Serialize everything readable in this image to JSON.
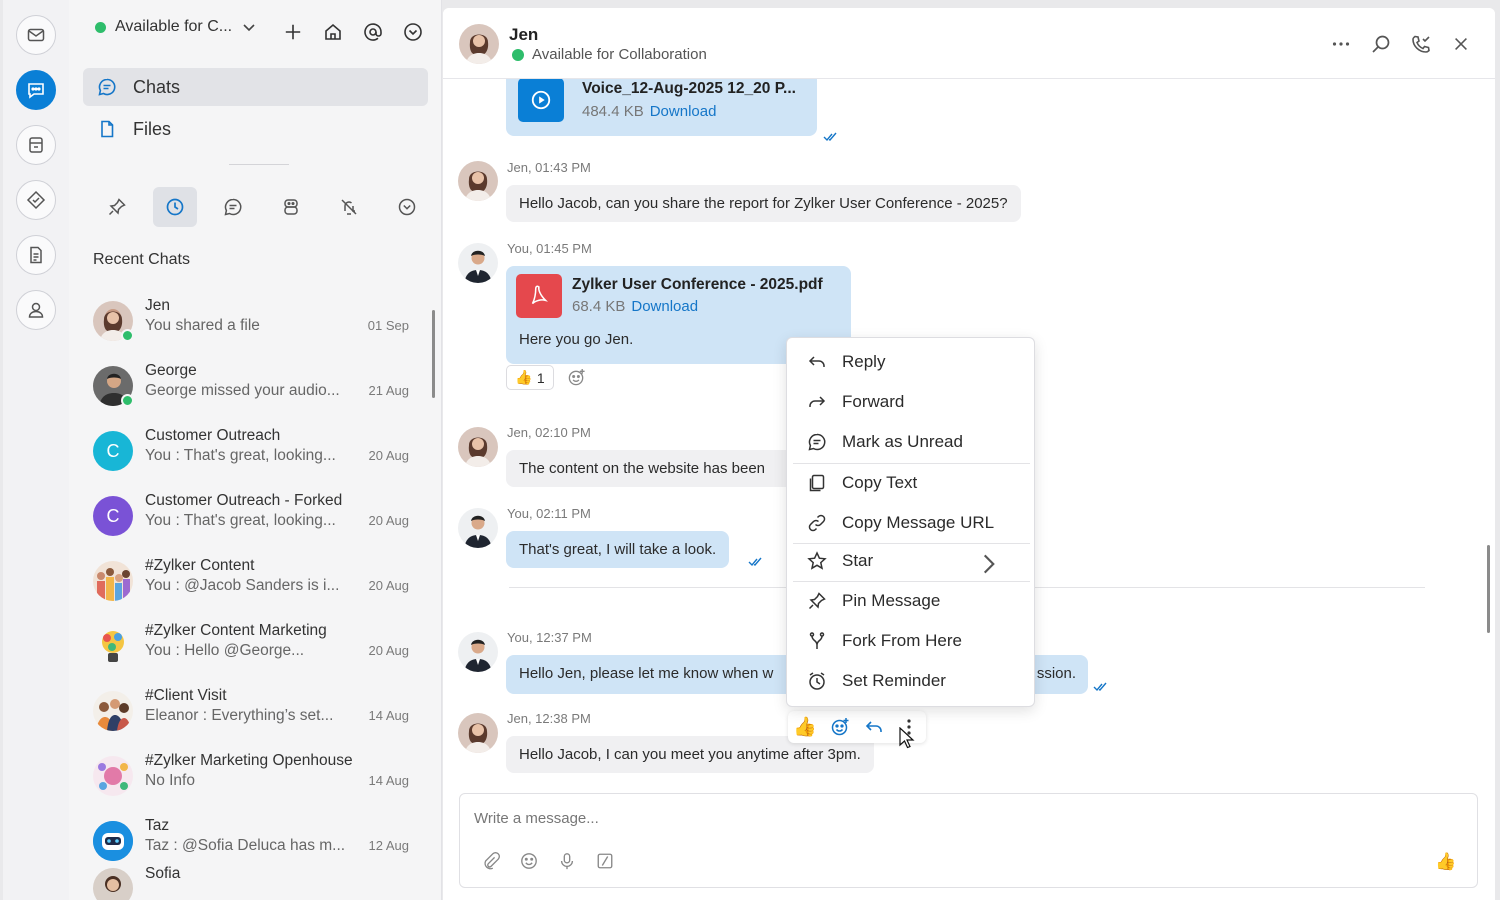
{
  "colors": {
    "accent": "#0a7fd6",
    "online": "#2ebd6b",
    "my_bubble": "#cfe4f6",
    "their_bubble": "#f0f0f2",
    "link": "#1576c8"
  },
  "rail": {
    "items": [
      "mail-icon",
      "chat-icon",
      "cart-icon",
      "verified-badge-icon",
      "notes-icon",
      "contacts-icon"
    ],
    "active": "chat-icon"
  },
  "sidebar": {
    "status_label": "Available for C...",
    "nav": [
      {
        "label": "Chats",
        "icon": "chat-bubble-icon",
        "active": true
      },
      {
        "label": "Files",
        "icon": "file-icon",
        "active": false
      }
    ],
    "filters": [
      "pin-icon",
      "clock-icon",
      "chat-bubble-icon",
      "bot-icon",
      "mute-icon",
      "chevron-circle-icon"
    ],
    "recent_title": "Recent Chats",
    "chats": [
      {
        "name": "Jen",
        "preview": "You shared a file",
        "date": "01 Sep",
        "online": true
      },
      {
        "name": "George",
        "preview": "George missed your audio...",
        "date": "21 Aug",
        "online": true
      },
      {
        "name": "Customer Outreach",
        "preview": "You : That's great, looking...",
        "date": "20 Aug",
        "initial": "C",
        "color": "#18b6d6"
      },
      {
        "name": "Customer Outreach - Forked",
        "preview": "You : That's great, looking...",
        "date": "20 Aug",
        "initial": "C",
        "color": "#7a52d6"
      },
      {
        "name": "#Zylker Content",
        "preview": "You : @Jacob Sanders is i...",
        "date": "20 Aug"
      },
      {
        "name": "#Zylker Content Marketing",
        "preview": "You : Hello @George...",
        "date": "20 Aug"
      },
      {
        "name": "#Client Visit",
        "preview": "Eleanor : Everything’s set...",
        "date": "14 Aug"
      },
      {
        "name": "#Zylker Marketing Openhouse",
        "preview": "No Info",
        "date": "14 Aug"
      },
      {
        "name": "Taz",
        "preview": "Taz : @Sofia Deluca has m...",
        "date": "12 Aug"
      },
      {
        "name": "Sofia",
        "preview": "",
        "date": ""
      }
    ]
  },
  "header": {
    "name": "Jen",
    "status": "Available for Collaboration"
  },
  "messages": {
    "voice": {
      "name": "Voice_12-Aug-2025 12_20 P...",
      "size": "484.4 KB",
      "action": "Download"
    },
    "m1": {
      "meta": "Jen, 01:43 PM",
      "text": "Hello Jacob, can you share the report for Zylker User Conference - 2025?"
    },
    "m2": {
      "meta": "You, 01:45 PM",
      "file": "Zylker User Conference - 2025.pdf",
      "size": "68.4 KB",
      "action": "Download",
      "text": "Here you go Jen.",
      "reaction": "👍",
      "reaction_count": "1"
    },
    "m3": {
      "meta": "Jen, 02:10 PM",
      "text": "The content on the website has been"
    },
    "m4": {
      "meta": "You, 02:11 PM",
      "text": "That's great, I will take a look."
    },
    "m5": {
      "meta": "You, 12:37 PM",
      "text_left": "Hello Jen, please let me know when w",
      "text_right": "ssion."
    },
    "m6": {
      "meta": "Jen, 12:38 PM",
      "text": "Hello Jacob, I can you meet you anytime after 3pm."
    }
  },
  "composer": {
    "placeholder": "Write a message..."
  },
  "context_menu": {
    "items": [
      {
        "label": "Reply",
        "icon": "reply-icon"
      },
      {
        "label": "Forward",
        "icon": "forward-icon"
      },
      {
        "label": "Mark as Unread",
        "icon": "mark-unread-icon"
      },
      {
        "label": "Copy Text",
        "icon": "copy-icon"
      },
      {
        "label": "Copy Message URL",
        "icon": "link-icon"
      },
      {
        "label": "Star",
        "icon": "star-icon"
      },
      {
        "label": "Pin Message",
        "icon": "pin-icon"
      },
      {
        "label": "Fork From Here",
        "icon": "fork-icon"
      },
      {
        "label": "Set Reminder",
        "icon": "alarm-icon"
      }
    ]
  }
}
